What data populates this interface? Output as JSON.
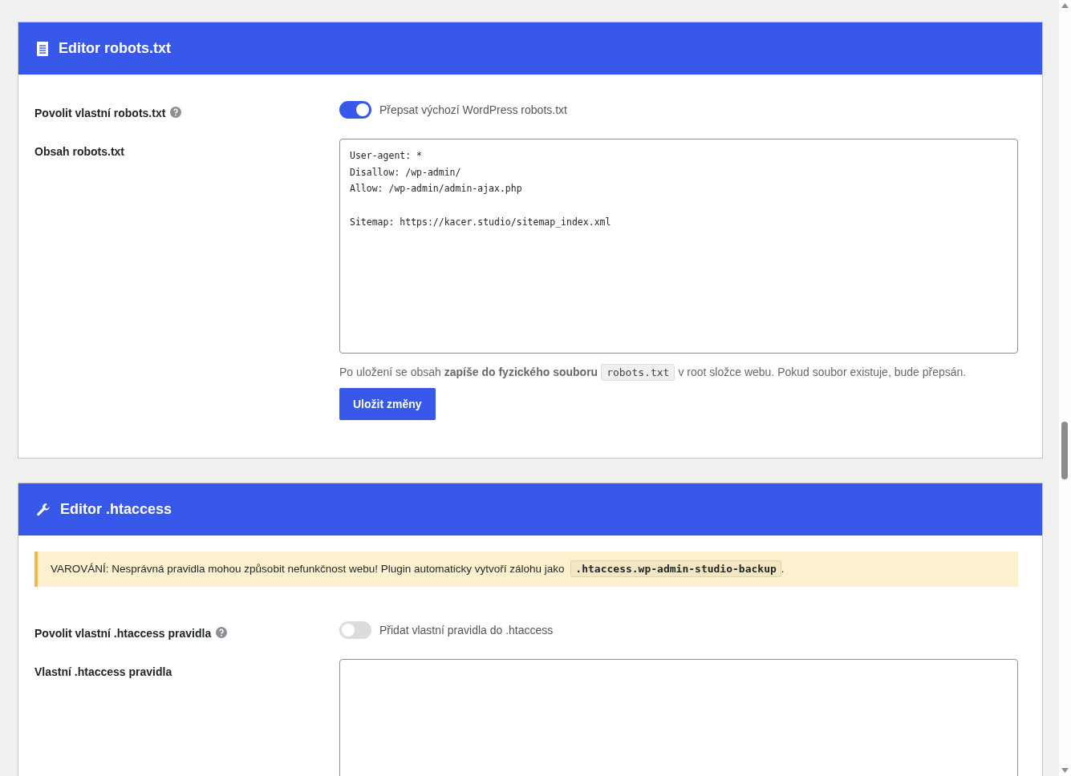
{
  "cards": [
    {
      "title": "Editor robots.txt",
      "toggle": {
        "label": "Povolit vlastní robots.txt",
        "caption": "Přepsat výchozí WordPress robots.txt",
        "on": true
      },
      "editor": {
        "label": "Obsah robots.txt",
        "content": "User-agent: *\nDisallow: /wp-admin/\nAllow: /wp-admin/admin-ajax.php\n\nSitemap: https://kacer.studio/sitemap_index.xml"
      },
      "note": {
        "before": "Po uložení se obsah **zapíše do fyzického souboru**",
        "code": "robots.txt",
        "after": "v root složce webu. Pokud soubor existuje, bude přepsán."
      },
      "button": "Uložit změny"
    },
    {
      "title": "Editor .htaccess",
      "warning": {
        "text": "VAROVÁNÍ: Nesprávná pravidla mohou způsobit nefunkčnost webu! Plugin automaticky vytvoří zálohu jako",
        "code": ".htaccess.wp-admin-studio-backup",
        "after": "."
      },
      "toggle": {
        "label": "Povolit vlastní .htaccess pravidla",
        "caption": "Přidat vlastní pravidla do .htaccess",
        "on": false
      },
      "editor": {
        "label": "Vlastní .htaccess pravidla"
      }
    }
  ]
}
